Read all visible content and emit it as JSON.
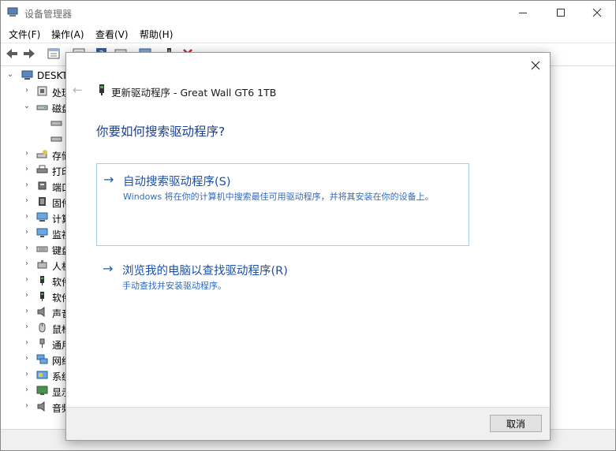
{
  "window": {
    "title": "设备管理器"
  },
  "menu": {
    "items": [
      "文件(F)",
      "操作(A)",
      "查看(V)",
      "帮助(H)"
    ]
  },
  "tree": {
    "root": "DESKT",
    "items": [
      {
        "label": "处理",
        "icon": "cpu-icon",
        "expanded": false
      },
      {
        "label": "磁盘",
        "icon": "disk-icon",
        "expanded": true
      },
      {
        "label": "",
        "icon": "disk-drive-icon",
        "child": true
      },
      {
        "label": "",
        "icon": "disk-drive-icon",
        "child": true
      },
      {
        "label": "存储",
        "icon": "storage-icon",
        "expanded": false
      },
      {
        "label": "打印",
        "icon": "printer-icon",
        "expanded": false
      },
      {
        "label": "端口",
        "icon": "port-icon",
        "expanded": false
      },
      {
        "label": "固件",
        "icon": "firmware-icon",
        "expanded": false
      },
      {
        "label": "计算",
        "icon": "computer-icon",
        "expanded": false
      },
      {
        "label": "监视",
        "icon": "monitor-icon",
        "expanded": false
      },
      {
        "label": "键盘",
        "icon": "keyboard-icon",
        "expanded": false
      },
      {
        "label": "人机",
        "icon": "hid-icon",
        "expanded": false
      },
      {
        "label": "软件",
        "icon": "software-component-icon",
        "expanded": false
      },
      {
        "label": "软件",
        "icon": "software-device-icon",
        "expanded": false
      },
      {
        "label": "声音",
        "icon": "sound-icon",
        "expanded": false
      },
      {
        "label": "鼠标",
        "icon": "mouse-icon",
        "expanded": false
      },
      {
        "label": "通用",
        "icon": "usb-icon",
        "expanded": false
      },
      {
        "label": "网络",
        "icon": "network-icon",
        "expanded": false
      },
      {
        "label": "系统",
        "icon": "system-icon",
        "expanded": false
      },
      {
        "label": "显示",
        "icon": "display-icon",
        "expanded": false
      },
      {
        "label": "音频",
        "icon": "audio-icon",
        "expanded": false
      }
    ]
  },
  "dialog": {
    "title": "更新驱动程序 - Great Wall GT6 1TB",
    "question": "你要如何搜索驱动程序?",
    "options": [
      {
        "title": "自动搜索驱动程序(S)",
        "description": "Windows 将在你的计算机中搜索最佳可用驱动程序，并将其安装在你的设备上。"
      },
      {
        "title": "浏览我的电脑以查找驱动程序(R)",
        "description": "手动查找并安装驱动程序。"
      }
    ],
    "cancel_label": "取消"
  },
  "colors": {
    "accent": "#1b4fa8",
    "option_border": "#a8cbe8",
    "remove_red": "#d9202a"
  }
}
